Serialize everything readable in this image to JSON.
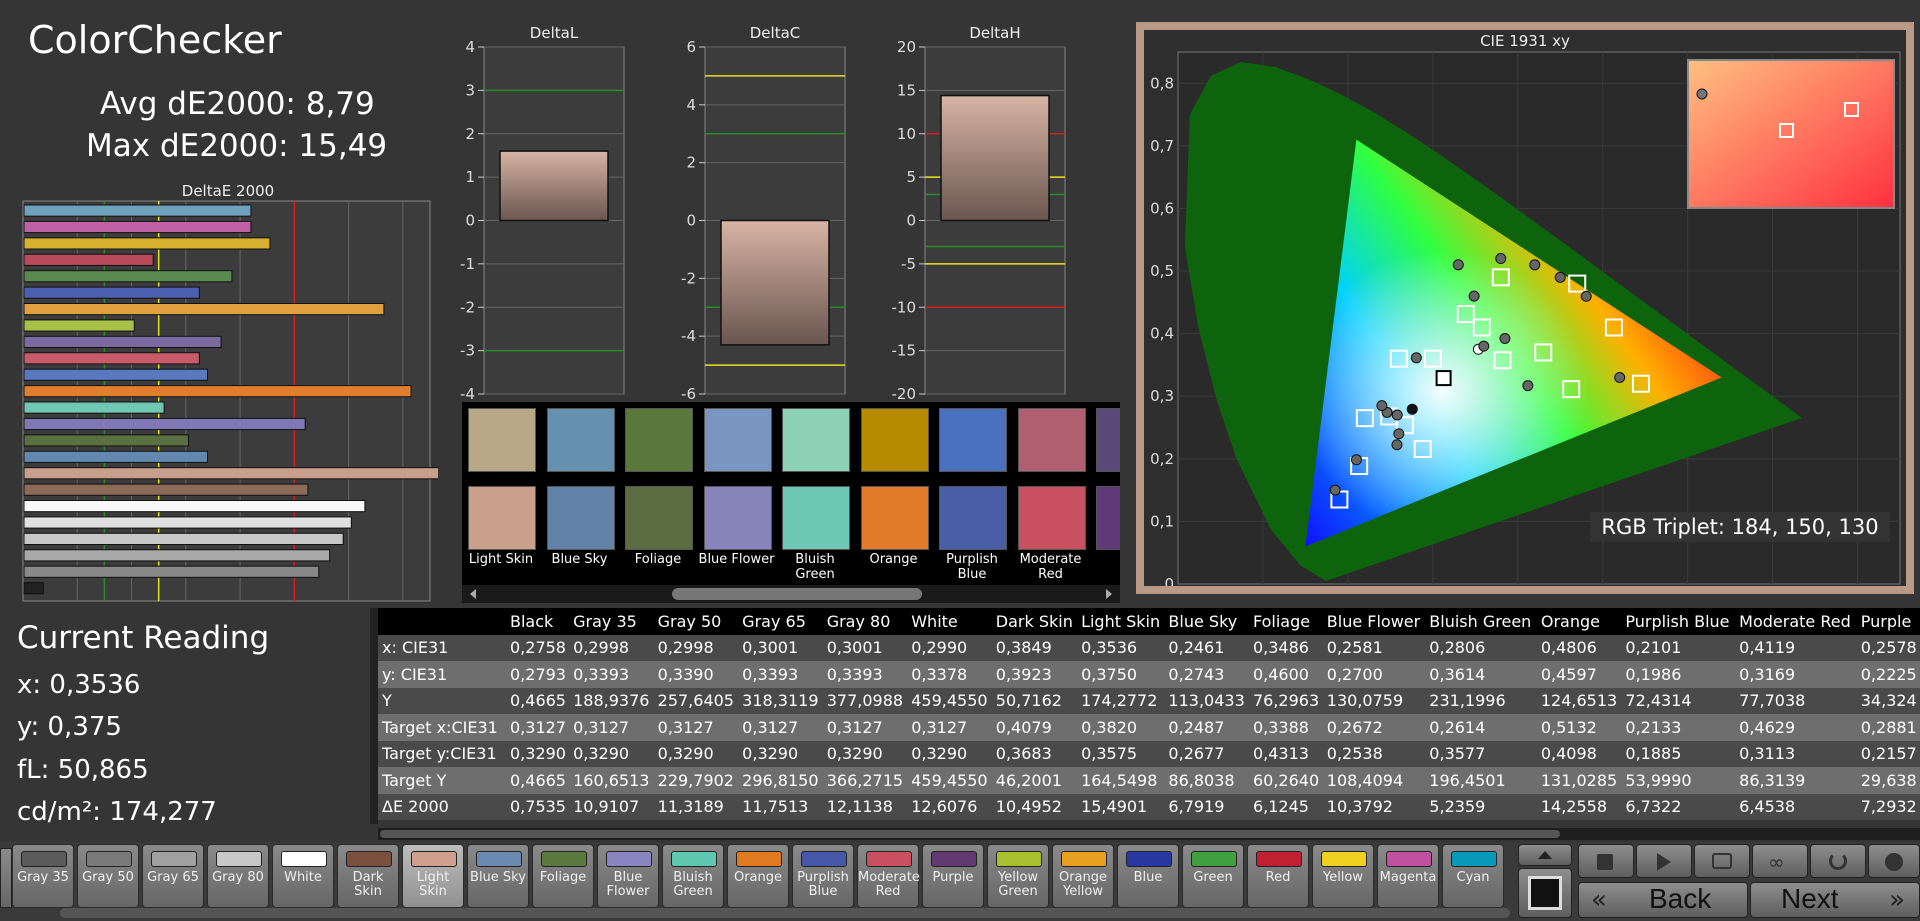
{
  "header": {
    "title": "ColorChecker",
    "avg": "Avg dE2000: 8,79",
    "max": "Max dE2000: 15,49"
  },
  "reading": {
    "title": "Current Reading",
    "x": "x: 0,3536",
    "y": "y: 0,375",
    "fl": "fL: 50,865",
    "cd": "cd/m²: 174,277"
  },
  "rgb_triplet": "RGB Triplet: 184, 150, 130",
  "deltae_chart": {
    "title": "DeltaE 2000",
    "type": "bar",
    "xlim": [
      0,
      15
    ],
    "x_ticks": [
      "0",
      "2",
      "4",
      "6",
      "8",
      "10",
      "12",
      "14"
    ],
    "values": [
      8.4,
      8.4,
      9.1,
      4.8,
      7.7,
      6.5,
      13.3,
      4.1,
      7.3,
      6.5,
      6.8,
      14.3,
      5.2,
      10.4,
      6.1,
      6.8,
      15.5,
      10.5,
      12.6,
      12.1,
      11.8,
      11.3,
      10.9,
      0.75
    ],
    "colors": [
      "#6fa0be",
      "#c060a6",
      "#d8b030",
      "#b84a5a",
      "#5a8a50",
      "#4d5fb0",
      "#e0a040",
      "#a8c048",
      "#7a6aa0",
      "#c85a6a",
      "#5878c0",
      "#e07e30",
      "#70c8b4",
      "#8078b4",
      "#5a7040",
      "#6288b0",
      "#c89e8c",
      "#8c6a58",
      "#f8f8f8",
      "#e0e0e0",
      "#c8c8c8",
      "#a8a8a8",
      "#888888",
      "#222222"
    ],
    "reference_lines": [
      {
        "value": 3,
        "color": "#2a8a2a"
      },
      {
        "value": 5,
        "color": "#e8e020"
      },
      {
        "value": 10,
        "color": "#d02020"
      }
    ]
  },
  "delta_charts": [
    {
      "title": "DeltaL",
      "ticks": [
        "4",
        "3",
        "2",
        "1",
        "0",
        "-1",
        "-2",
        "-3",
        "-4"
      ],
      "ylim": [
        -4,
        4
      ],
      "value": 1.6,
      "lines": [
        {
          "v": 3,
          "c": "#2a8a2a"
        },
        {
          "v": -3,
          "c": "#2a8a2a"
        }
      ]
    },
    {
      "title": "DeltaC",
      "ticks": [
        "6",
        "4",
        "2",
        "0",
        "-2",
        "-4",
        "-6"
      ],
      "ylim": [
        -6,
        6
      ],
      "value": -4.3,
      "lines": [
        {
          "v": 5,
          "c": "#e8e020"
        },
        {
          "v": 3,
          "c": "#2a8a2a"
        },
        {
          "v": -3,
          "c": "#2a8a2a"
        },
        {
          "v": -5,
          "c": "#e8e020"
        }
      ]
    },
    {
      "title": "DeltaH",
      "ticks": [
        "20",
        "15",
        "10",
        "5",
        "0",
        "-5",
        "-10",
        "-15",
        "-20"
      ],
      "ylim": [
        -20,
        20
      ],
      "value": 14.4,
      "lines": [
        {
          "v": 10,
          "c": "#d02020"
        },
        {
          "v": 5,
          "c": "#e8e020"
        },
        {
          "v": 3,
          "c": "#2a8a2a"
        },
        {
          "v": -3,
          "c": "#2a8a2a"
        },
        {
          "v": -5,
          "c": "#e8e020"
        },
        {
          "v": -10,
          "c": "#d02020"
        }
      ]
    }
  ],
  "swatches": [
    {
      "label": "Light Skin",
      "target": "#b8a888",
      "measured": "#c8a08c"
    },
    {
      "label": "Blue Sky",
      "target": "#6690b0",
      "measured": "#6283a8"
    },
    {
      "label": "Foliage",
      "target": "#5a783c",
      "measured": "#5a6c40"
    },
    {
      "label": "Blue Flower",
      "target": "#7a96c0",
      "measured": "#8884bc"
    },
    {
      "label": "Bluish Green",
      "target": "#8cd0b8",
      "measured": "#6cc8b4"
    },
    {
      "label": "Orange",
      "target": "#b88a00",
      "measured": "#e07c2c"
    },
    {
      "label": "Purplish Blue",
      "target": "#4a70c0",
      "measured": "#4a5ea8"
    },
    {
      "label": "Moderate Red",
      "target": "#b06070",
      "measured": "#c85060"
    },
    {
      "label": "Pu",
      "target": "#5a4878",
      "measured": "#603a78"
    }
  ],
  "cie": {
    "title": "CIE 1931 xy",
    "x_ticks": [
      "0",
      "0,1",
      "0,2",
      "0,3",
      "0,4",
      "0,5",
      "0,6",
      "0,7",
      "0,8"
    ],
    "y_ticks": [
      "0,8",
      "0,7",
      "0,6",
      "0,5",
      "0,4",
      "0,3",
      "0,2",
      "0,1",
      "0"
    ],
    "targets": [
      [
        0.3127,
        0.329
      ],
      [
        0.382,
        0.3575
      ],
      [
        0.2487,
        0.2677
      ],
      [
        0.3388,
        0.4313
      ],
      [
        0.2672,
        0.2538
      ],
      [
        0.3577,
        0.4098
      ],
      [
        0.5132,
        0.4098
      ],
      [
        0.2133,
        0.1885
      ],
      [
        0.4629,
        0.3113
      ],
      [
        0.2881,
        0.2157
      ],
      [
        0.3,
        0.36
      ],
      [
        0.38,
        0.49
      ],
      [
        0.47,
        0.48
      ],
      [
        0.19,
        0.135
      ],
      [
        0.26,
        0.36
      ],
      [
        0.22,
        0.265
      ],
      [
        0.545,
        0.32
      ],
      [
        0.43,
        0.37
      ]
    ],
    "measured": [
      [
        0.2758,
        0.2793
      ],
      [
        0.3849,
        0.3923
      ],
      [
        0.3536,
        0.375
      ],
      [
        0.2461,
        0.2743
      ],
      [
        0.3486,
        0.46
      ],
      [
        0.2581,
        0.27
      ],
      [
        0.2806,
        0.3614
      ],
      [
        0.4806,
        0.4597
      ],
      [
        0.2101,
        0.1986
      ],
      [
        0.4119,
        0.3169
      ],
      [
        0.2578,
        0.2225
      ],
      [
        0.38,
        0.52
      ],
      [
        0.42,
        0.51
      ],
      [
        0.185,
        0.15
      ],
      [
        0.24,
        0.285
      ],
      [
        0.26,
        0.24
      ],
      [
        0.52,
        0.33
      ],
      [
        0.33,
        0.51
      ],
      [
        0.45,
        0.49
      ],
      [
        0.36,
        0.38
      ]
    ]
  },
  "table": {
    "headers": [
      "",
      "Black",
      "Gray 35",
      "Gray 50",
      "Gray 65",
      "Gray 80",
      "White",
      "Dark Skin",
      "Light Skin",
      "Blue Sky",
      "Foliage",
      "Blue Flower",
      "Bluish Green",
      "Orange",
      "Purplish Blue",
      "Moderate Red",
      "Purple"
    ],
    "rows": [
      [
        "x: CIE31",
        "0,2758",
        "0,2998",
        "0,2998",
        "0,3001",
        "0,3001",
        "0,2990",
        "0,3849",
        "0,3536",
        "0,2461",
        "0,3486",
        "0,2581",
        "0,2806",
        "0,4806",
        "0,2101",
        "0,4119",
        "0,2578"
      ],
      [
        "y: CIE31",
        "0,2793",
        "0,3393",
        "0,3390",
        "0,3393",
        "0,3393",
        "0,3378",
        "0,3923",
        "0,3750",
        "0,2743",
        "0,4600",
        "0,2700",
        "0,3614",
        "0,4597",
        "0,1986",
        "0,3169",
        "0,2225"
      ],
      [
        "Y",
        "0,4665",
        "188,9376",
        "257,6405",
        "318,3119",
        "377,0988",
        "459,4550",
        "50,7162",
        "174,2772",
        "113,0433",
        "76,2963",
        "130,0759",
        "231,1996",
        "124,6513",
        "72,4314",
        "77,7038",
        "34,324"
      ],
      [
        "Target x:CIE31",
        "0,3127",
        "0,3127",
        "0,3127",
        "0,3127",
        "0,3127",
        "0,3127",
        "0,4079",
        "0,3820",
        "0,2487",
        "0,3388",
        "0,2672",
        "0,2614",
        "0,5132",
        "0,2133",
        "0,4629",
        "0,2881"
      ],
      [
        "Target y:CIE31",
        "0,3290",
        "0,3290",
        "0,3290",
        "0,3290",
        "0,3290",
        "0,3290",
        "0,3683",
        "0,3575",
        "0,2677",
        "0,4313",
        "0,2538",
        "0,3577",
        "0,4098",
        "0,1885",
        "0,3113",
        "0,2157"
      ],
      [
        "Target Y",
        "0,4665",
        "160,6513",
        "229,7902",
        "296,8150",
        "366,2715",
        "459,4550",
        "46,2001",
        "164,5498",
        "86,8038",
        "60,2640",
        "108,4094",
        "196,4501",
        "131,0285",
        "53,9990",
        "86,3139",
        "29,638"
      ],
      [
        "ΔE 2000",
        "0,7535",
        "10,9107",
        "11,3189",
        "11,7513",
        "12,1138",
        "12,6076",
        "10,4952",
        "15,4901",
        "6,7919",
        "6,1245",
        "10,3792",
        "5,2359",
        "14,2558",
        "6,7322",
        "6,4538",
        "7,2932"
      ]
    ]
  },
  "patch_buttons": [
    {
      "label": "Gray 35",
      "color": "#5a5a5a"
    },
    {
      "label": "Gray 50",
      "color": "#7a7a7a"
    },
    {
      "label": "Gray 65",
      "color": "#a0a0a0"
    },
    {
      "label": "Gray 80",
      "color": "#c8c8c8"
    },
    {
      "label": "White",
      "color": "#ffffff"
    },
    {
      "label": "Dark Skin",
      "color": "#7a5040"
    },
    {
      "label": "Light Skin",
      "color": "#d0a08c"
    },
    {
      "label": "Blue Sky",
      "color": "#6a8ab0"
    },
    {
      "label": "Foliage",
      "color": "#5a7a40"
    },
    {
      "label": "Blue Flower",
      "color": "#8a84c0"
    },
    {
      "label": "Bluish Green",
      "color": "#60c8b0"
    },
    {
      "label": "Orange",
      "color": "#e07a20"
    },
    {
      "label": "Purplish Blue",
      "color": "#4858a8"
    },
    {
      "label": "Moderate Red",
      "color": "#c85060"
    },
    {
      "label": "Purple",
      "color": "#603a70"
    },
    {
      "label": "Yellow Green",
      "color": "#a8c030"
    },
    {
      "label": "Orange Yellow",
      "color": "#e8a020"
    },
    {
      "label": "Blue",
      "color": "#2838a0"
    },
    {
      "label": "Green",
      "color": "#40a040"
    },
    {
      "label": "Red",
      "color": "#c02030"
    },
    {
      "label": "Yellow",
      "color": "#f0d020"
    },
    {
      "label": "Magenta",
      "color": "#c050a0"
    },
    {
      "label": "Cyan",
      "color": "#0898b8"
    }
  ],
  "nav": {
    "back": "Back",
    "next": "Next"
  }
}
